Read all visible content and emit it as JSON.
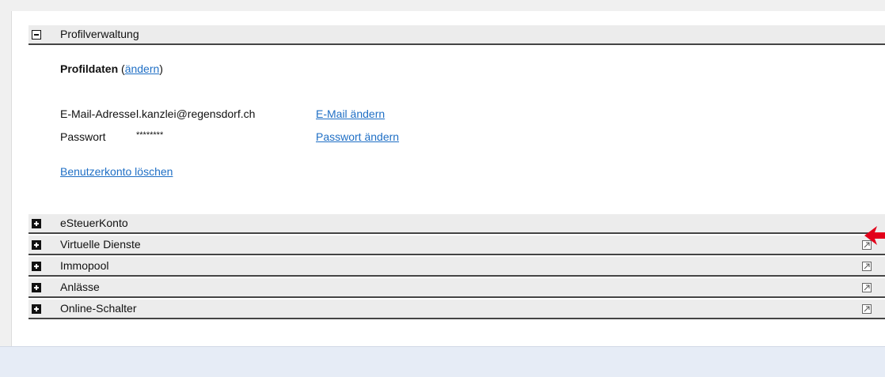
{
  "profile_section": {
    "title": "Profilverwaltung",
    "profile_heading": "Profildaten",
    "edit_open": "(",
    "edit_link": "ändern",
    "edit_close": ")",
    "email_label": "E-Mail-Adresse",
    "email_value": "l.kanzlei@regensdorf.ch",
    "email_change_link": "E-Mail ändern",
    "password_label": "Passwort",
    "password_value": "********",
    "password_change_link": "Passwort ändern",
    "delete_account_link": "Benutzerkonto löschen"
  },
  "sections": [
    {
      "title": "eSteuerKonto"
    },
    {
      "title": "Virtuelle Dienste"
    },
    {
      "title": "Immopool"
    },
    {
      "title": "Anlässe"
    },
    {
      "title": "Online-Schalter"
    }
  ],
  "colors": {
    "link": "#1f6fc5",
    "header_bg": "#ececec",
    "annotation_arrow": "#e2001a"
  }
}
